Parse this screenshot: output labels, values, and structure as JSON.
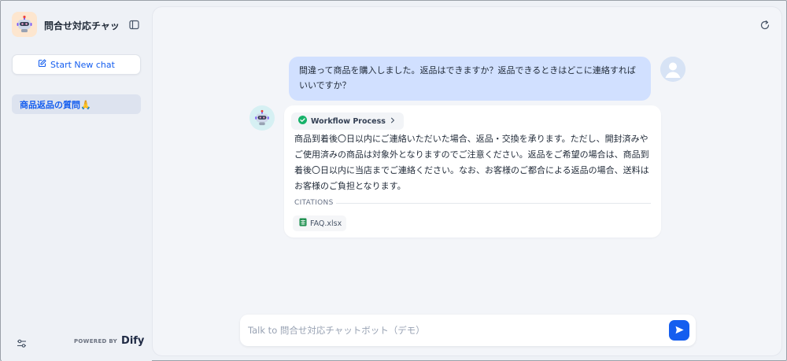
{
  "sidebar": {
    "app_title": "問合せ対応チャッ...",
    "new_chat_label": "Start New chat",
    "conversations": [
      {
        "label": "商品返品の質問🙏"
      }
    ],
    "powered_by": "POWERED BY",
    "brand": "Dify"
  },
  "chat": {
    "user_message": "間違って商品を購入しました。返品はできますか？返品できるときはどこに連絡すればいいですか？",
    "workflow_label": "Workflow Process",
    "bot_message": "商品到着後〇日以内にご連絡いただいた場合、返品・交換を承ります。ただし、開封済みやご使用済みの商品は対象外となりますのでご注意ください。返品をご希望の場合は、商品到着後〇日以内に当店までご連絡ください。なお、お客様のご都合による返品の場合、送料はお客様のご負担となります。",
    "citations_label": "CITATIONS",
    "citations": [
      {
        "file": "FAQ.xlsx"
      }
    ]
  },
  "input": {
    "placeholder": "Talk to 問合せ対応チャットボット（デモ）",
    "value": ""
  },
  "colors": {
    "accent": "#155eef",
    "user_bubble": "#d1e0ff",
    "selected_item": "#dde3ef",
    "success": "#17b26a",
    "excel_green": "#1d8f4e"
  },
  "icons": {
    "app_logo": "robot-icon",
    "collapse": "sidebar-collapse-icon",
    "new_chat": "edit-icon",
    "settings": "settings-sliders-icon",
    "refresh": "refresh-icon",
    "user_avatar": "user-icon",
    "bot_avatar": "robot-icon",
    "workflow_status": "check-circle-icon",
    "workflow_expand": "chevron-right-icon",
    "citation_file": "spreadsheet-icon",
    "send": "send-icon"
  }
}
